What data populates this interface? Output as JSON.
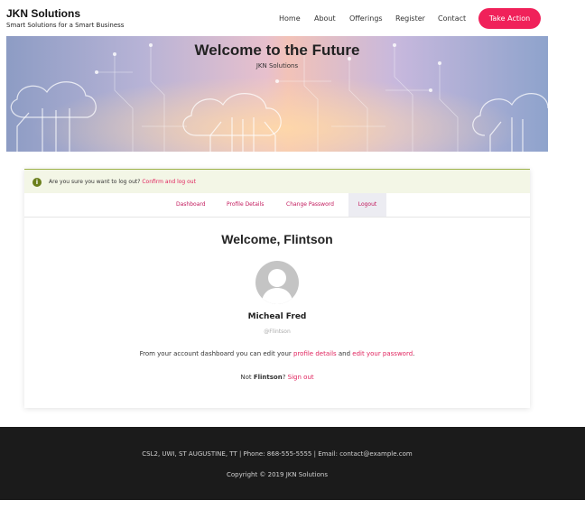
{
  "header": {
    "brand_title": "JKN Solutions",
    "brand_tagline": "Smart Solutions for a Smart Business",
    "nav": [
      "Home",
      "About",
      "Offerings",
      "Register",
      "Contact"
    ],
    "cta_label": "Take Action"
  },
  "hero": {
    "title": "Welcome to the Future",
    "subtitle": "JKN Solutions"
  },
  "notice": {
    "text": "Are you sure you want to log out?",
    "link": "Confirm and log out",
    "icon": "info-icon"
  },
  "tabs": [
    "Dashboard",
    "Profile Details",
    "Change Password",
    "Logout"
  ],
  "account": {
    "welcome": "Welcome, Flintson",
    "display_name": "Micheal Fred",
    "username": "@Flintson",
    "dashboard_text_before": "From your account dashboard you can edit your ",
    "profile_link": "profile details",
    "dashboard_text_middle": " and ",
    "password_link": "edit your password",
    "dashboard_text_after": ".",
    "not_prefix": "Not ",
    "not_user": "Flintson",
    "not_suffix": "? ",
    "sign_out": "Sign out"
  },
  "footer": {
    "address_line": "CSL2, UWI, ST AUGUSTINE, TT | Phone: 868-555-5555 | Email: contact@example.com",
    "copyright": "Copyright © 2019 JKN Solutions"
  },
  "colors": {
    "accent": "#f0215a",
    "link": "#e0245e",
    "footer_bg": "#1b1b1b",
    "notice_bg": "#f3f6e6"
  }
}
